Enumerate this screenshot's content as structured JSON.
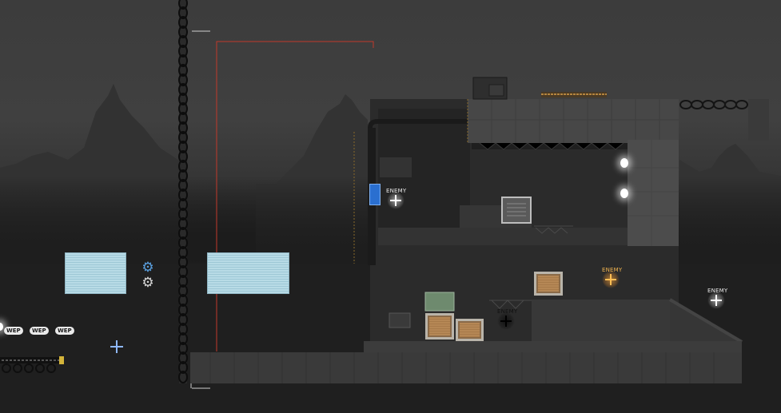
{
  "game": {
    "enemy_label": "ENEMY",
    "weapon_label": "WEP",
    "enemies": [
      {
        "type": "white"
      },
      {
        "type": "orange"
      },
      {
        "type": "dark"
      },
      {
        "type": "white"
      }
    ],
    "weapons_in_loadout": 3
  },
  "icons": {
    "gear_active": "gear-icon",
    "gear_inactive": "gear-icon",
    "crosshair": "crosshair-icon"
  },
  "colors": {
    "selection_outline": "#c0392b",
    "glass": "#b8dbe6",
    "enemy_orange": "#ffbe55",
    "gear_blue": "#5aa0e0"
  }
}
